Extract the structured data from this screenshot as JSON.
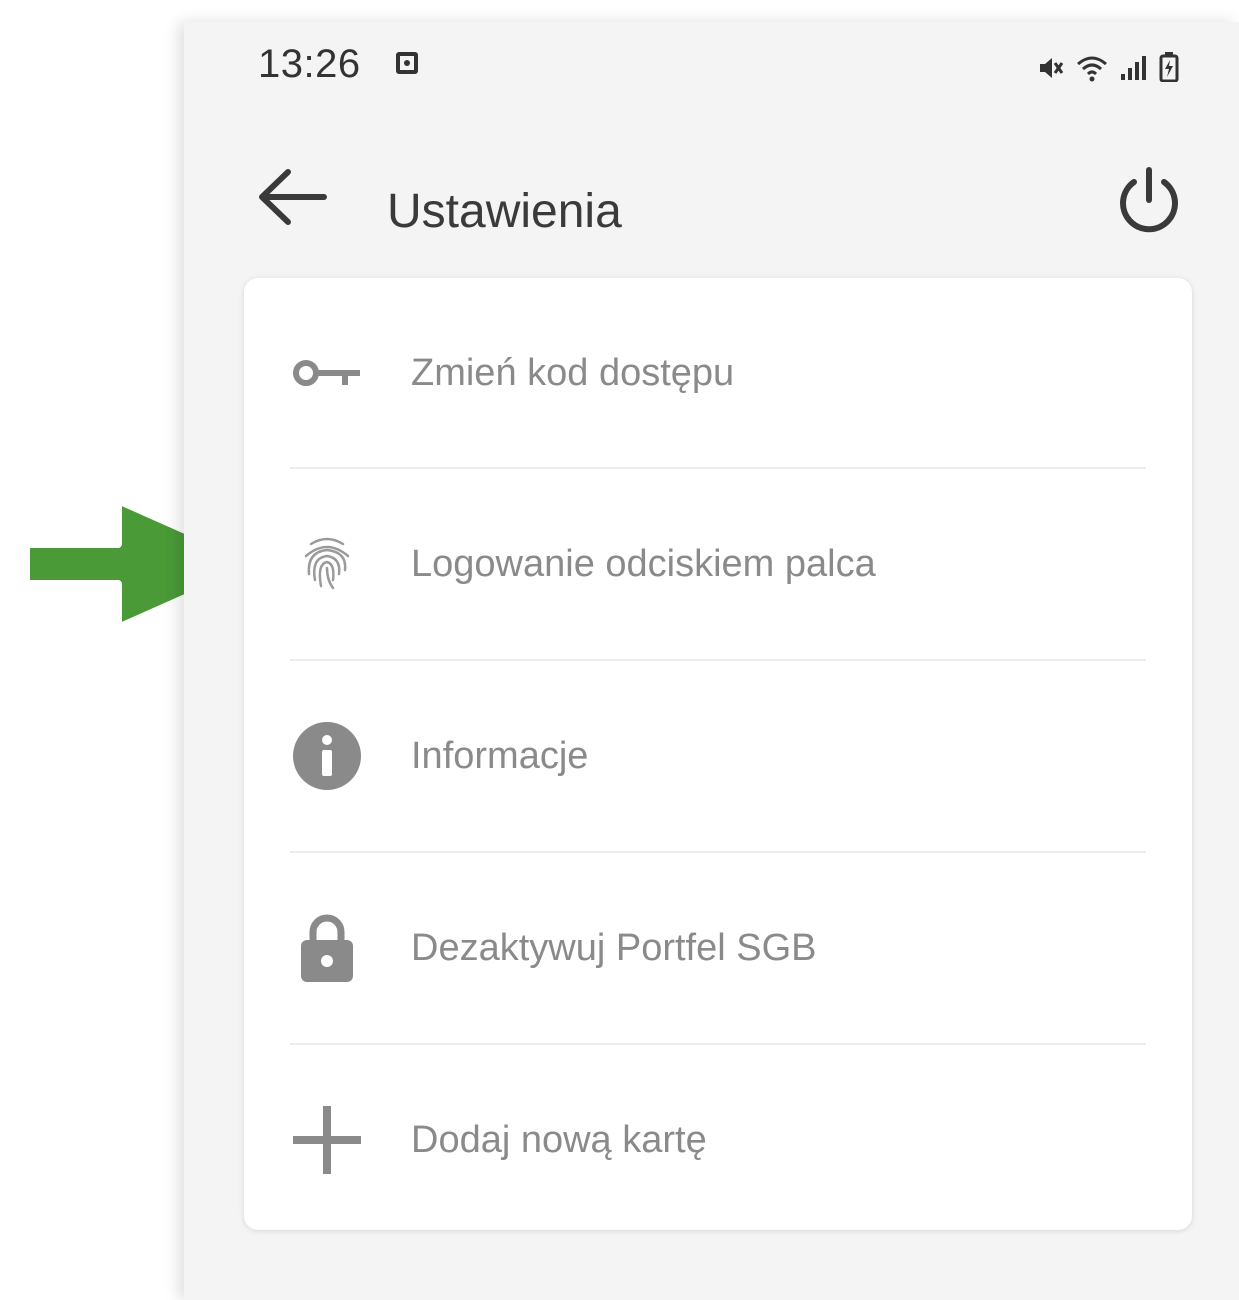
{
  "status_bar": {
    "time": "13:26",
    "notification_icon": "notification-square-icon",
    "right_icons": [
      "mute-icon",
      "wifi-icon",
      "signal-icon",
      "battery-charging-icon"
    ]
  },
  "app_bar": {
    "title": "Ustawienia",
    "back_icon": "arrow-left-icon",
    "power_icon": "power-icon"
  },
  "settings": {
    "items": [
      {
        "label": "Zmień kod dostępu",
        "icon": "key-icon"
      },
      {
        "label": "Logowanie odciskiem palca",
        "icon": "fingerprint-icon"
      },
      {
        "label": "Informacje",
        "icon": "info-icon"
      },
      {
        "label": "Dezaktywuj Portfel SGB",
        "icon": "lock-icon"
      },
      {
        "label": "Dodaj nową kartę",
        "icon": "plus-icon"
      }
    ]
  },
  "annotation": {
    "icon": "green-arrow-icon",
    "color": "#4a9a37"
  },
  "colors": {
    "background": "#f4f4f4",
    "card": "#ffffff",
    "icon_gray": "#8a8a8a",
    "title_text": "#3a3a3a"
  }
}
